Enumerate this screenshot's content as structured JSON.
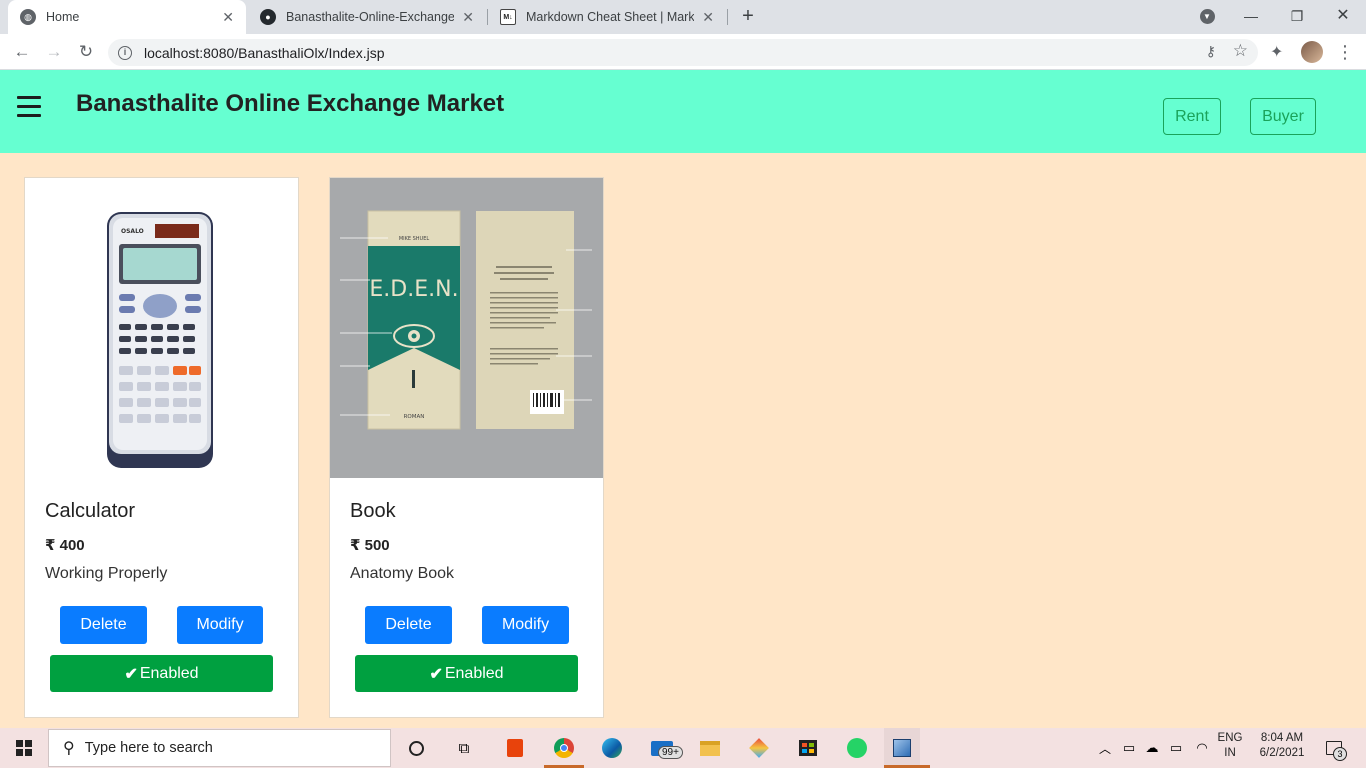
{
  "browser": {
    "tabs": [
      {
        "label": "Home",
        "close": "✕"
      },
      {
        "label": "Banasthalite-Online-Exchange-M",
        "close": "✕"
      },
      {
        "label": "Markdown Cheat Sheet | Markdo",
        "close": "✕"
      }
    ],
    "url": "localhost:8080/BanasthaliOlx/Index.jsp"
  },
  "navbar": {
    "brand": "Banasthalite Online Exchange Market",
    "buttons": {
      "rent": "Rent",
      "buyer": "Buyer"
    },
    "colors": {
      "background": "#66ffd1",
      "accent": "#1aa35a"
    }
  },
  "products": [
    {
      "title": "Calculator",
      "price": "₹ 400",
      "description": "Working Properly",
      "delete_label": "Delete",
      "modify_label": "Modify",
      "status_label": "Enabled"
    },
    {
      "title": "Book",
      "price": "₹ 500",
      "description": "Anatomy Book",
      "delete_label": "Delete",
      "modify_label": "Modify",
      "status_label": "Enabled"
    }
  ],
  "book_image": {
    "cover_title": "E.D.E.N.",
    "author": "MIKE SHUEL",
    "genre": "ROMAN"
  },
  "calculator_image": {
    "brand": "OSALO"
  },
  "taskbar": {
    "search_placeholder": "Type here to search",
    "mail_badge": "99+",
    "language": "ENG",
    "region": "IN",
    "time": "8:04 AM",
    "date": "6/2/2021",
    "notifications": "3"
  },
  "colors": {
    "page_background": "#ffe6c8",
    "primary_button": "#0a7cff",
    "enabled_button": "#00a040"
  }
}
